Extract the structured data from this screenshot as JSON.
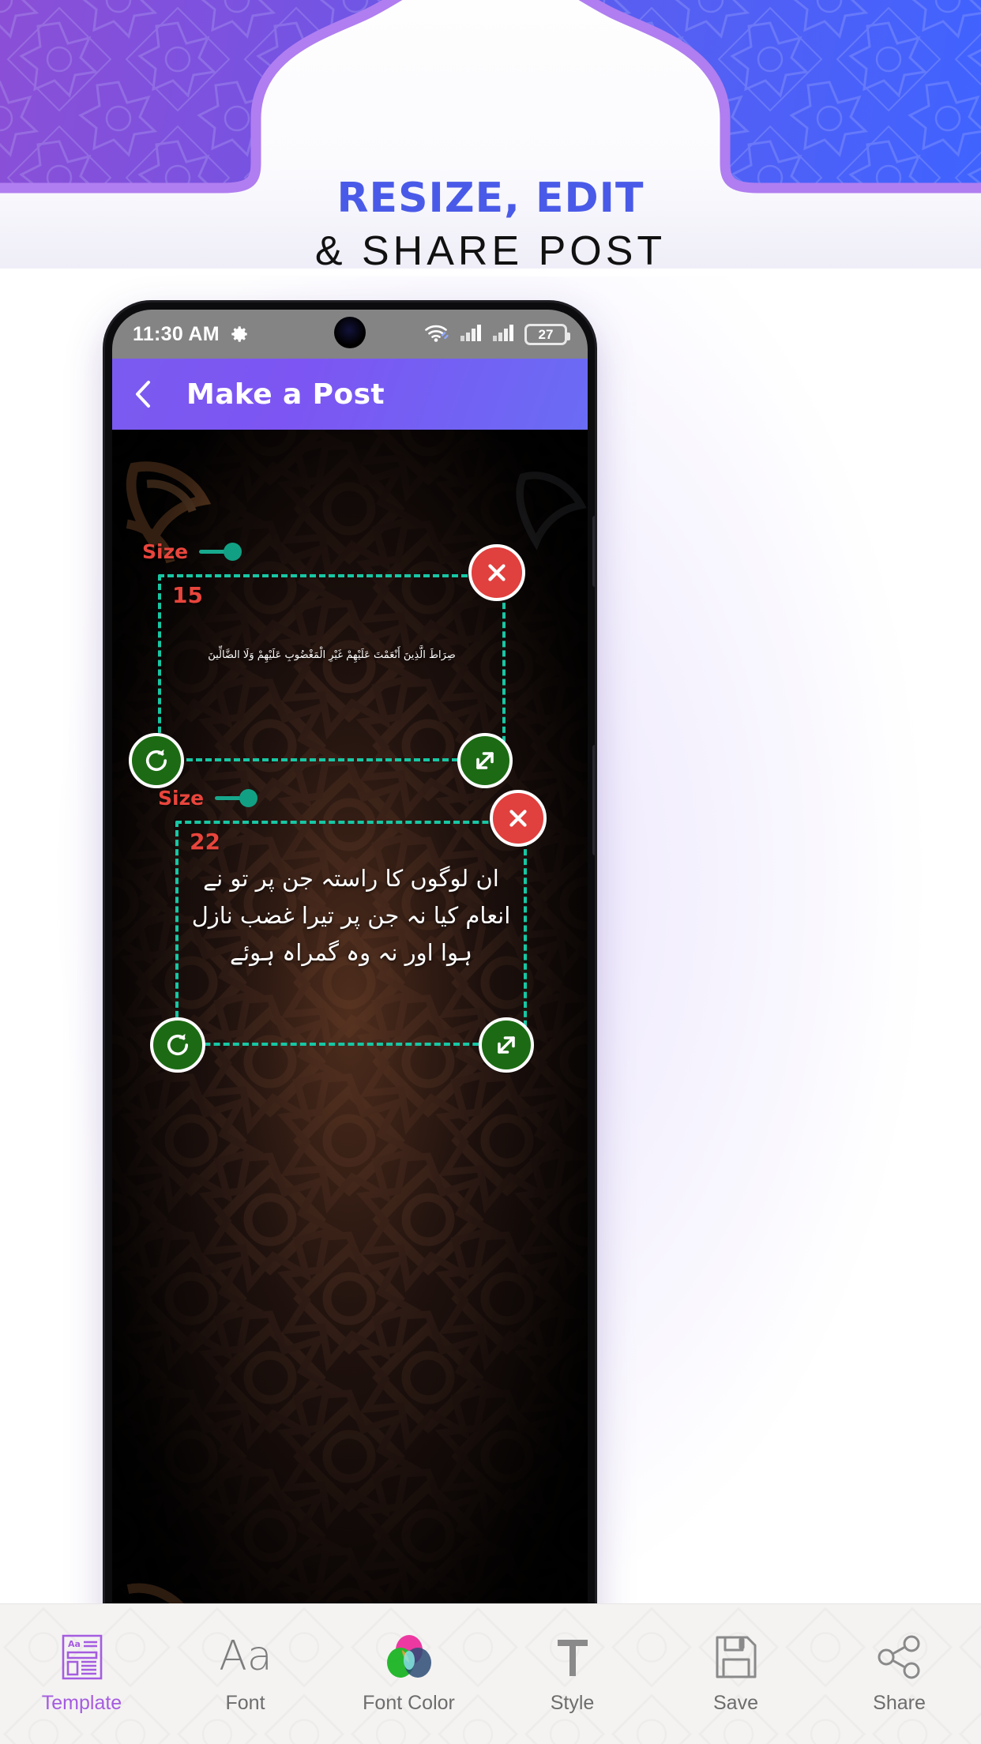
{
  "banner": {
    "title_line1": "RESIZE, EDIT",
    "title_line2": "& SHARE POST",
    "title_line1_color": "#4a5ae8",
    "title_line2_color": "#111111",
    "gradient_from": "#8b4fd6",
    "gradient_to": "#3f63ff",
    "arch_outline_color": "#b07ef0"
  },
  "phone": {
    "statusbar": {
      "time": "11:30 AM",
      "gear_icon": "gear-icon",
      "wifi_icon": "wifi-link-icon",
      "signal_icon_1": "signal-bars-icon",
      "signal_icon_2": "signal-bars-icon",
      "battery_level": "27",
      "background": "#848484"
    },
    "appbar": {
      "back_icon": "chevron-left-icon",
      "title": "Make a Post",
      "gradient_from": "#7a5bf0",
      "gradient_to": "#6a6cf5"
    }
  },
  "canvas": {
    "accent_selection_color": "#17c7a4",
    "size_label_color": "#e8453c",
    "items": [
      {
        "size_label": "Size",
        "size_value": "15",
        "text": "صِرَاطَ الَّذِينَ أَنْعَمْتَ عَلَيْهِمْ غَيْرِ الْمَغْضُوبِ عَلَيْهِمْ وَلَا الضَّالِّينَ",
        "close_icon": "close-x-icon",
        "rotate_icon": "rotate-cw-icon",
        "resize_icon": "resize-diagonal-arrow-icon"
      },
      {
        "size_label": "Size",
        "size_value": "22",
        "text": "ان لوگوں کا راستہ جن پر تو نے انعام کیا نہ جن پر تیرا غضب نازل ہوا اور نہ وہ گمراہ ہوئے",
        "close_icon": "close-x-icon",
        "rotate_icon": "rotate-cw-icon",
        "resize_icon": "resize-diagonal-arrow-icon"
      }
    ]
  },
  "toolbar": {
    "items": [
      {
        "label": "Template",
        "icon": "template-document-icon",
        "active": true
      },
      {
        "label": "Font",
        "icon": "font-aa-icon",
        "active": false
      },
      {
        "label": "Font Color",
        "icon": "color-circles-icon",
        "active": false
      },
      {
        "label": "Style",
        "icon": "text-style-t-icon",
        "active": false
      },
      {
        "label": "Save",
        "icon": "floppy-disk-icon",
        "active": false
      },
      {
        "label": "Share",
        "icon": "share-nodes-icon",
        "active": false
      }
    ],
    "active_color": "#a55ce0",
    "inactive_color": "#6d6d6d"
  }
}
